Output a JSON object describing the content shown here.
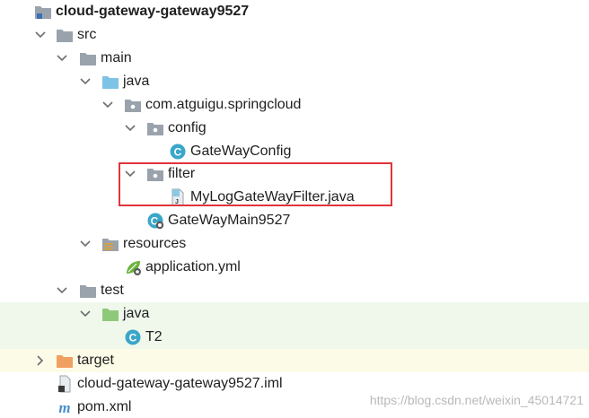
{
  "tree": {
    "root": "cloud-gateway-gateway9527",
    "src": "src",
    "main": "main",
    "java_main": "java",
    "package": "com.atguigu.springcloud",
    "config": "config",
    "config_class": "GateWayConfig",
    "filter": "filter",
    "filter_class": "MyLogGateWayFilter.java",
    "main_class": "GateWayMain9527",
    "resources": "resources",
    "app_yml": "application.yml",
    "test": "test",
    "java_test": "java",
    "test_class": "T2",
    "target": "target",
    "iml": "cloud-gateway-gateway9527.iml",
    "pom": "pom.xml"
  },
  "watermark": "https://blog.csdn.net/weixin_45014721",
  "colors": {
    "folder_gray": "#9aa3ab",
    "folder_blue": "#7ec3e6",
    "folder_green": "#8ec97a",
    "folder_orange": "#f0a060",
    "class_cyan": "#3aa6c9",
    "highlight": "#e0353a",
    "test_bg": "#f0f8ec",
    "excluded_bg": "#fcfbe7"
  }
}
